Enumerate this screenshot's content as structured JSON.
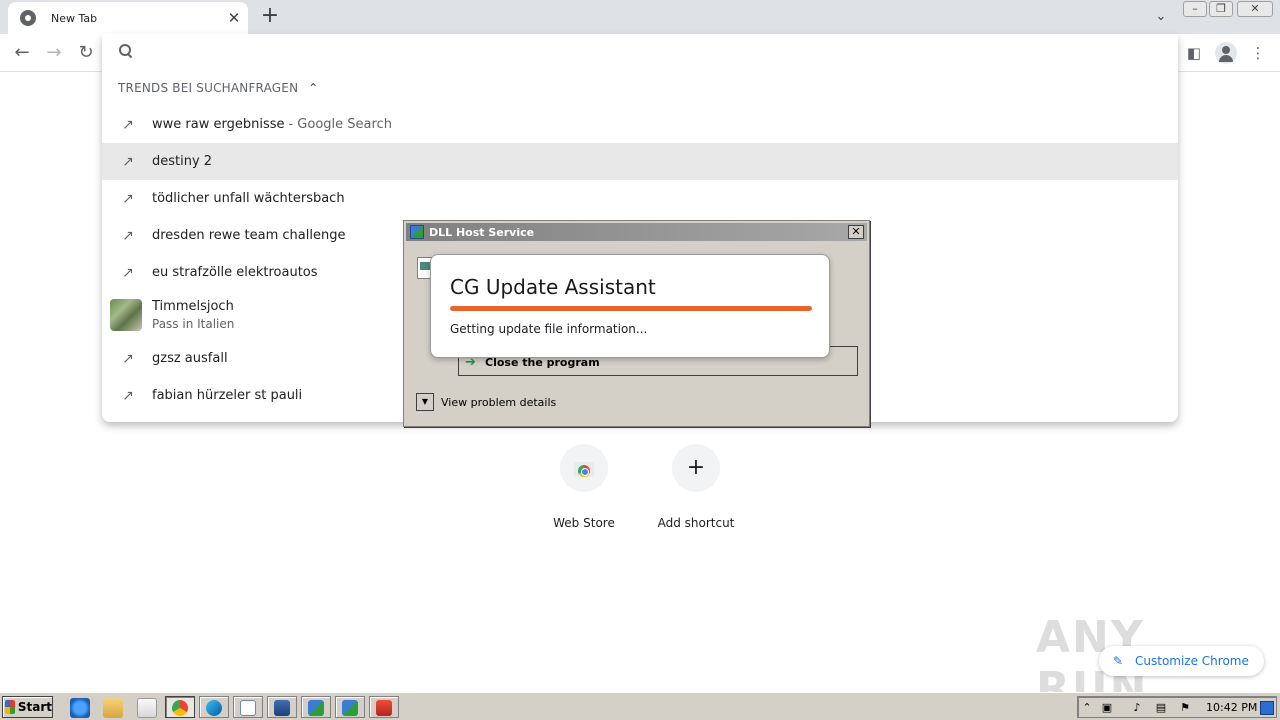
{
  "browser": {
    "tab": {
      "title": "New Tab"
    },
    "omnibox": {
      "value": ""
    }
  },
  "suggestions": {
    "header": "TRENDS BEI SUCHANFRAGEN",
    "items": [
      {
        "text": "wwe raw ergebnisse",
        "suffix": "- Google Search",
        "icon": "trending-icon"
      },
      {
        "text": "destiny 2",
        "icon": "trending-icon",
        "selected": true
      },
      {
        "text": "tödlicher unfall wächtersbach",
        "icon": "trending-icon"
      },
      {
        "text": "dresden rewe team challenge",
        "icon": "trending-icon"
      },
      {
        "text": "eu strafzölle elektroautos",
        "icon": "trending-icon"
      },
      {
        "text": "Timmelsjoch",
        "subtext": "Pass in Italien",
        "icon": "thumbnail"
      },
      {
        "text": "gzsz ausfall",
        "icon": "trending-icon"
      },
      {
        "text": "fabian hürzeler st pauli",
        "icon": "trending-icon"
      }
    ]
  },
  "shortcuts": [
    {
      "label": "Web Store",
      "icon": "web-store-icon"
    },
    {
      "label": "Add shortcut",
      "icon": "plus-icon"
    }
  ],
  "customize": {
    "label": "Customize Chrome"
  },
  "watermark": {
    "text": "ANY RUN"
  },
  "dialog": {
    "title": "DLL Host Service",
    "close_program": "Close the program",
    "view_details": "View problem details"
  },
  "popup": {
    "title": "CG Update Assistant",
    "status": "Getting update file information...",
    "progress": 1.0,
    "accent": "#e8642a"
  },
  "taskbar": {
    "start_label": "Start",
    "time": "10:42 PM"
  }
}
